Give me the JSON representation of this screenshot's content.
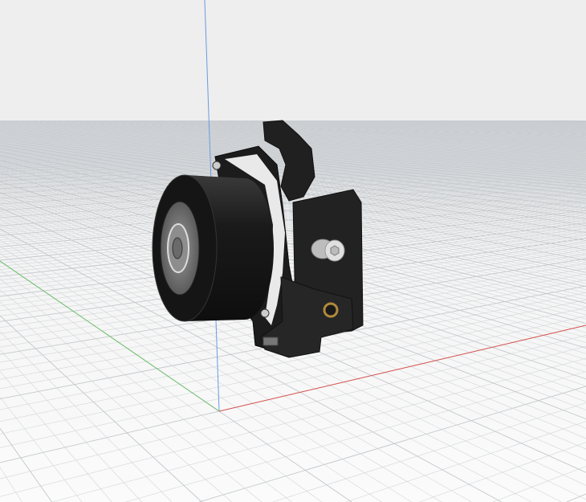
{
  "viewport": {
    "background_top": "#efefef",
    "background_bottom": "#fbfbfb",
    "grid_color": "#d2d5d8",
    "grid_major_color": "#c3c7cb",
    "axis_colors": {
      "x": "#d9534f",
      "y": "#5cb85c",
      "z": "#6a9be0"
    }
  },
  "model": {
    "body_color": "#1e1e1e",
    "highlight_color": "#e8e8e8",
    "brass_color": "#b08a3c"
  }
}
